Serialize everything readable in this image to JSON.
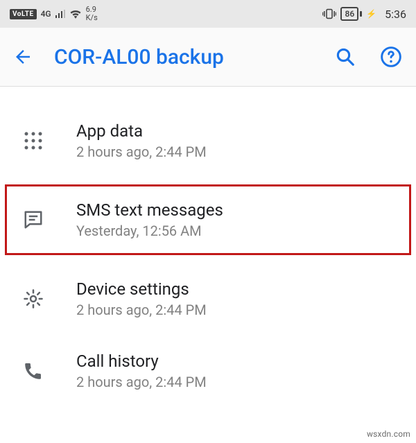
{
  "status": {
    "volte": "VoLTE",
    "network_gen": "4G",
    "speed_value": "6.9",
    "speed_unit": "K/s",
    "battery_percent": "86",
    "charging_glyph": "⚡",
    "clock": "5:36"
  },
  "header": {
    "title": "COR-AL00 backup"
  },
  "items": [
    {
      "icon": "apps",
      "title": "App data",
      "subtitle": "2 hours ago, 2:44 PM",
      "highlight": false
    },
    {
      "icon": "sms",
      "title": "SMS text messages",
      "subtitle": "Yesterday, 12:56 AM",
      "highlight": true
    },
    {
      "icon": "settings",
      "title": "Device settings",
      "subtitle": "2 hours ago, 2:44 PM",
      "highlight": false
    },
    {
      "icon": "phone",
      "title": "Call history",
      "subtitle": "2 hours ago, 2:44 PM",
      "highlight": false
    }
  ],
  "watermark": "wsxdn.com"
}
